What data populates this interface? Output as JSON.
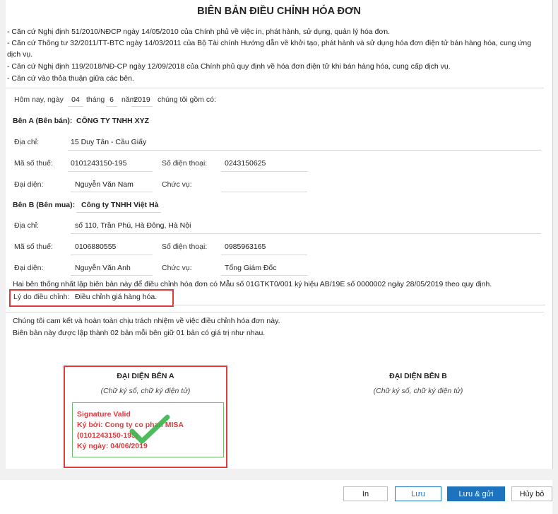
{
  "document": {
    "title": "BIÊN BẢN ĐIỀU CHỈNH HÓA ĐƠN",
    "basis": [
      "- Căn cứ Nghị định 51/2010/NĐCP ngày 14/05/2010 của Chính phủ về việc in, phát hành, sử dụng, quản lý hóa đơn.",
      "- Căn cứ Thông tư 32/2011/TT-BTC ngày 14/03/2011 của Bộ Tài chính Hướng dẫn về khởi tạo, phát hành và sử dụng hóa đơn điện tử bán hàng hóa, cung ứng",
      "dịch vụ.",
      "- Căn cứ Nghị định 119/2018/NĐ-CP ngày 12/09/2018 của Chính phủ quy định về hóa đơn điện tử khi bán hàng hóa, cung cấp dịch vụ.",
      "- Căn cứ vào thỏa thuận giữa các bên."
    ],
    "date_line": {
      "prefix": "Hôm nay, ngày",
      "day": "04",
      "month_label": "tháng",
      "month": "6",
      "year_label": "năm",
      "year": "2019",
      "suffix": "chúng tôi gồm có:"
    },
    "party_a": {
      "header": "Bên A (Bên bán):",
      "name": "CÔNG TY TNHH XYZ",
      "address_label": "Địa chỉ:",
      "address": "15 Duy Tân - Cầu Giấy",
      "tax_label": "Mã số thuế:",
      "tax": "0101243150-195",
      "phone_label": "Số điện thoại:",
      "phone": "0243150625",
      "rep_label": "Đại diện:",
      "rep": "Nguyễn Văn Nam",
      "pos_label": "Chức vụ:",
      "pos": ""
    },
    "party_b": {
      "header": "Bên B (Bên mua):",
      "name": "Công ty TNHH Việt Hà",
      "address_label": "Địa chỉ:",
      "address": "số 110, Trần Phú, Hà Đông, Hà Nội",
      "tax_label": "Mã số thuế:",
      "tax": "0106880555",
      "phone_label": "Số điện thoại:",
      "phone": "0985963165",
      "rep_label": "Đại diện:",
      "rep": "Nguyễn Văn Anh",
      "pos_label": "Chức vụ:",
      "pos": "Tổng Giám Đốc"
    },
    "agreement": "Hai bên thống nhất lập biên bản này để điều chỉnh hóa đơn có Mẫu số 01GTKT0/001 ký hiệu AB/19E số 0000002 ngày 28/05/2019 theo quy định.",
    "reason_label": "Lý do điều chỉnh:",
    "reason": "Điều chỉnh giá hàng hóa.",
    "commit_1": "Chúng tôi cam kết và hoàn toàn chịu trách nhiệm về việc điều chỉnh hóa đơn này.",
    "commit_2": "Biên bản này được lập thành 02 bản mỗi bên giữ 01 bản có giá trị như nhau.",
    "sign_a": {
      "title": "ĐẠI DIỆN BÊN A",
      "note": "(Chữ ký số, chữ ký điện tử)"
    },
    "sign_b": {
      "title": "ĐẠI DIỆN BÊN B",
      "note": "(Chữ ký số, chữ ký điện tử)"
    },
    "signature": {
      "status": "Signature Valid",
      "signed_by": "Ký bởi: Cong ty co phan MISA",
      "tax": "(0101243150-195)",
      "date": "Ký ngày: 04/06/2019",
      "check_icon": "green-checkmark-icon",
      "color": "#e0393e"
    }
  },
  "footer": {
    "print_label": "In",
    "save_label": "Lưu",
    "save_send_label": "Lưu & gửi",
    "cancel_label": "Hủy bỏ"
  },
  "colors": {
    "accent": "#1e73be",
    "highlight": "#e0393e",
    "signature_border": "#6dbf6d"
  }
}
